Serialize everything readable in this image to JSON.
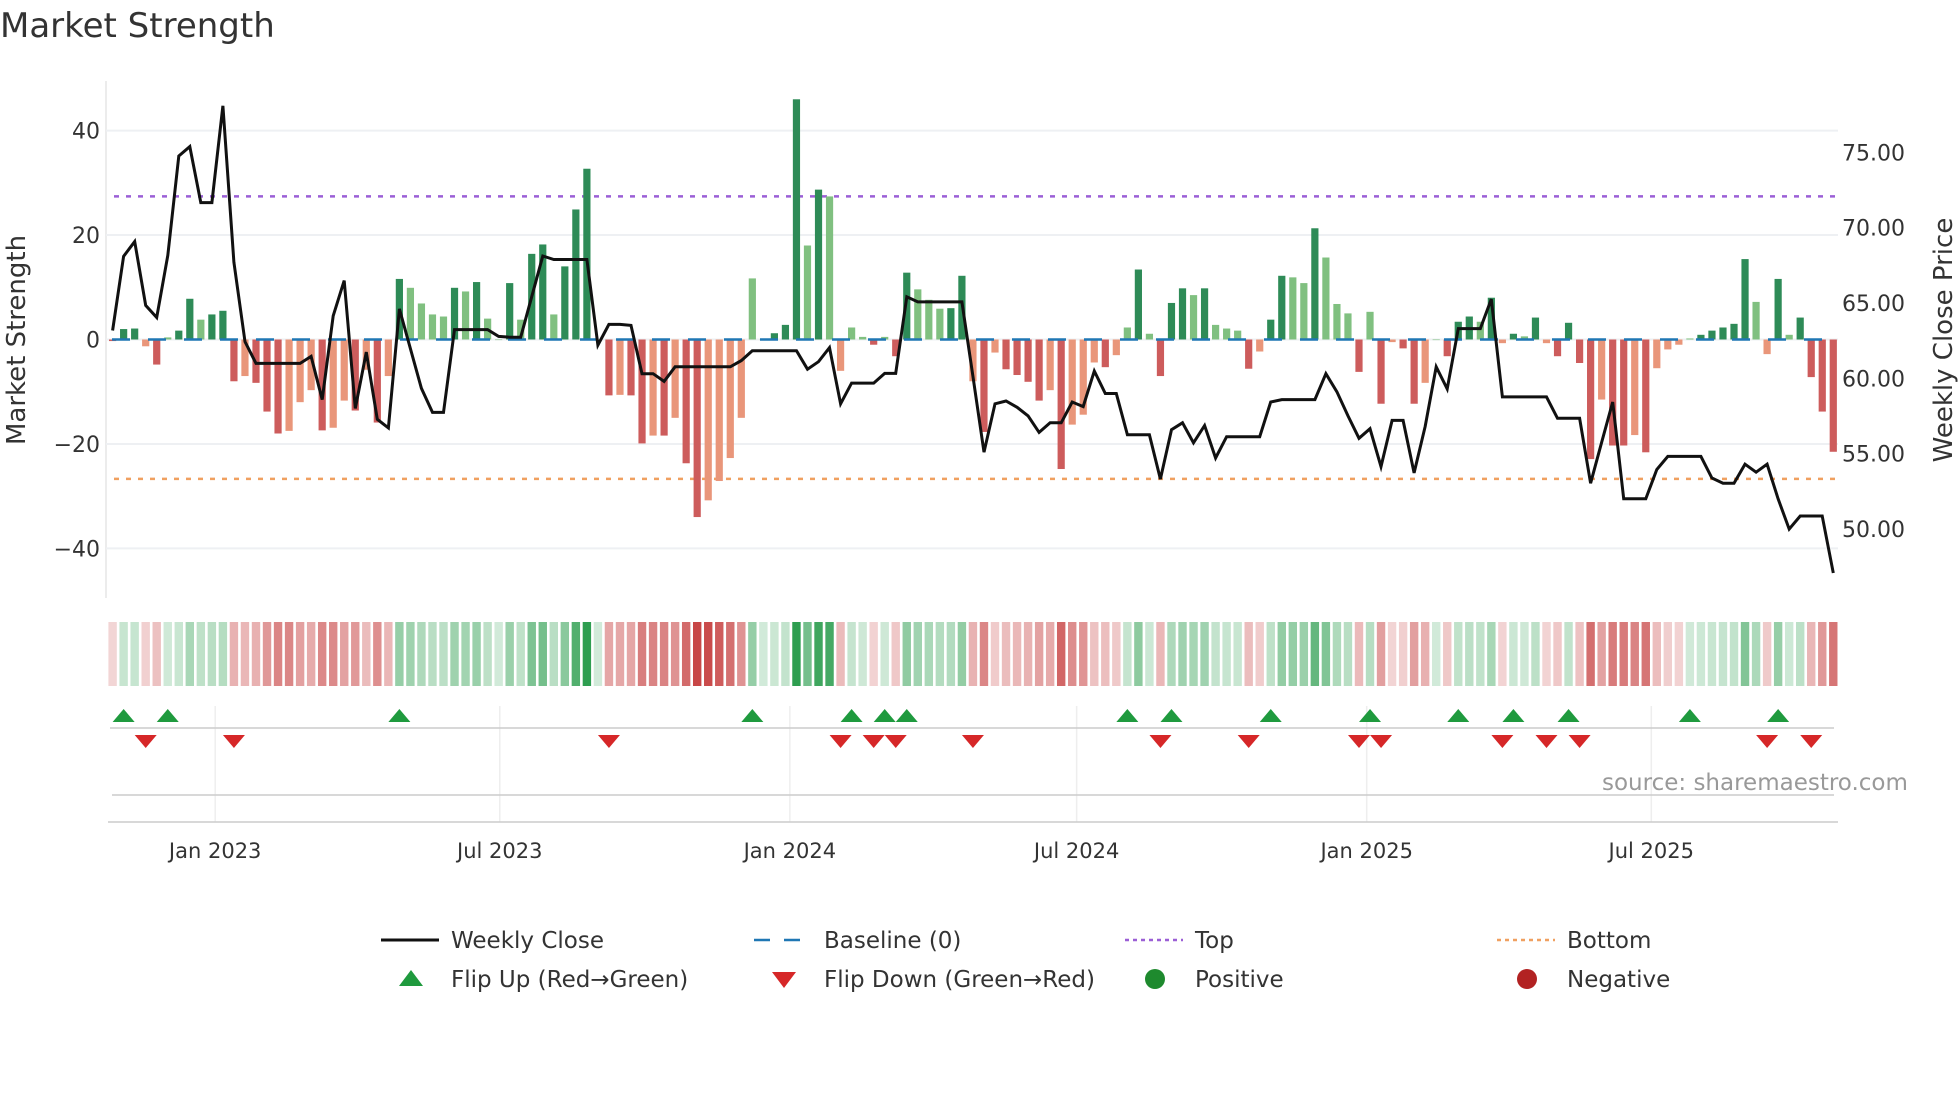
{
  "title": "Market Strength",
  "source": "source: sharemaestro.com",
  "colors": {
    "strong_green": "#2e8b57",
    "light_green": "#80c080",
    "strong_red": "#cd5c5c",
    "light_red": "#e9967a",
    "baseline": "#1f77b4",
    "top": "#9b5fd6",
    "bottom": "#f0a060",
    "flip_up": "#1f9a3e",
    "flip_down": "#d62728",
    "positive": "#1e8a2e",
    "negative": "#b22222"
  },
  "chart_data": {
    "type": "bar",
    "title": "Market Strength",
    "ylabel": "Market Strength",
    "y2label": "Weekly Close Price",
    "ylim": [
      -49.5,
      49.5
    ],
    "y2lim": [
      45.4,
      79.75
    ],
    "yticks": [
      40,
      20,
      0,
      -20,
      -40
    ],
    "yticklabels": [
      "40",
      "20",
      "0",
      "−20",
      "−40"
    ],
    "y2ticks": [
      75,
      70,
      65,
      60,
      55,
      50
    ],
    "y2ticklabels": [
      "75.00",
      "70.00",
      "65.00",
      "60.00",
      "55.00",
      "50.00"
    ],
    "xticks": [
      {
        "index": 9.3,
        "label": "Jan 2023"
      },
      {
        "index": 35.1,
        "label": "Jul 2023"
      },
      {
        "index": 61.4,
        "label": "Jan 2024"
      },
      {
        "index": 87.4,
        "label": "Jul 2024"
      },
      {
        "index": 113.7,
        "label": "Jan 2025"
      },
      {
        "index": 139.5,
        "label": "Jul 2025"
      }
    ],
    "top_level": 27.4,
    "bottom_level": -26.7,
    "baseline": 0,
    "grid": true,
    "legend_position": "bottom",
    "strength": [
      -0.3,
      2,
      2.1,
      -1.3,
      -4.8,
      0.4,
      1.7,
      7.8,
      3.8,
      4.8,
      5.5,
      -8,
      -7,
      -8.3,
      -13.8,
      -18,
      -17.5,
      -12,
      -9.7,
      -17.4,
      -16.9,
      -11.7,
      -13.6,
      -5.8,
      -15.9,
      -7,
      11.6,
      9.9,
      6.9,
      4.8,
      4.4,
      9.9,
      9.2,
      11,
      4,
      0,
      10.8,
      3.8,
      16.4,
      18.2,
      4.8,
      14,
      24.9,
      32.7,
      0,
      -10.7,
      -10.6,
      -10.7,
      -19.9,
      -18.4,
      -18.4,
      -15,
      -23.7,
      -34,
      -30.8,
      -27.1,
      -22.7,
      -15,
      11.7,
      0,
      1.2,
      2.8,
      46,
      18,
      28.7,
      27.4,
      -6,
      2.3,
      0.5,
      -1,
      0.5,
      -3.2,
      12.8,
      9.6,
      7.6,
      5.9,
      6,
      12.2,
      -8,
      -17.7,
      -2.5,
      -5.7,
      -6.8,
      -8.1,
      -11.7,
      -9.7,
      -24.8,
      -16.3,
      -14.4,
      -4.4,
      -5.3,
      -3,
      2.3,
      13.4,
      1.1,
      -7,
      7,
      9.8,
      8.5,
      9.8,
      2.8,
      2.1,
      1.7,
      -5.6,
      -2.3,
      3.8,
      12.2,
      11.9,
      10.8,
      21.3,
      15.7,
      6.8,
      5,
      -6.2,
      5.3,
      -12.3,
      -0.5,
      -1.7,
      -12.3,
      -8.3,
      0,
      -3.2,
      3.4,
      4.4,
      3.4,
      8,
      -0.7,
      1.1,
      0.6,
      4.2,
      -0.7,
      -3.2,
      3.2,
      -4.5,
      -22.9,
      -11.5,
      -20.3,
      -20.3,
      -18.3,
      -21.6,
      -5.5,
      -1.9,
      -1,
      0.2,
      0.9,
      1.7,
      2.3,
      3,
      15.4,
      7.2,
      -2.8,
      11.6,
      0.9,
      4.2,
      -7.2,
      -13.8,
      -21.5
    ],
    "weekly_close": [
      63.17,
      68.1,
      69.08,
      64.84,
      64.04,
      68.16,
      74.77,
      75.39,
      71.67,
      71.67,
      78.1,
      67.71,
      62.43,
      60.99,
      60.99,
      60.99,
      60.99,
      60.99,
      61.45,
      58.58,
      64.15,
      66.49,
      58.0,
      61.74,
      57.27,
      56.7,
      64.61,
      61.97,
      59.33,
      57.73,
      57.73,
      63.23,
      63.23,
      63.23,
      63.23,
      62.78,
      62.73,
      62.73,
      65.41,
      68.12,
      67.89,
      67.89,
      67.89,
      67.89,
      62.2,
      63.58,
      63.58,
      63.51,
      60.3,
      60.3,
      59.79,
      60.76,
      60.76,
      60.76,
      60.76,
      60.76,
      60.76,
      61.17,
      61.83,
      61.83,
      61.83,
      61.83,
      61.83,
      60.6,
      61.1,
      62.04,
      58.3,
      59.68,
      59.68,
      59.68,
      60.32,
      60.32,
      65.41,
      65.07,
      65.07,
      65.07,
      65.07,
      65.07,
      60.14,
      55.09,
      58.3,
      58.49,
      58.07,
      57.5,
      56.4,
      57.04,
      57.04,
      58.42,
      58.12,
      60.48,
      58.99,
      58.99,
      56.24,
      56.24,
      56.24,
      53.3,
      56.58,
      57.04,
      55.71,
      56.86,
      54.7,
      56.12,
      56.12,
      56.12,
      56.12,
      58.42,
      58.58,
      58.58,
      58.58,
      58.58,
      60.3,
      59.1,
      57.5,
      56.01,
      56.65,
      54.13,
      57.2,
      57.2,
      53.71,
      56.81,
      60.76,
      59.29,
      63.3,
      63.3,
      63.3,
      65.25,
      58.76,
      58.76,
      58.76,
      58.76,
      58.76,
      57.34,
      57.34,
      57.34,
      53.03,
      55.73,
      58.42,
      51.99,
      51.99,
      51.99,
      53.94,
      54.81,
      54.81,
      54.81,
      54.81,
      53.37,
      53.03,
      53.03,
      54.29,
      53.76,
      54.29,
      51.99,
      49.98,
      50.85,
      50.85,
      50.85,
      47.06
    ]
  },
  "legend": [
    {
      "label": "Weekly Close",
      "symbol": "line"
    },
    {
      "label": "Baseline (0)",
      "symbol": "dash"
    },
    {
      "label": "Top",
      "symbol": "dot-purple"
    },
    {
      "label": "Bottom",
      "symbol": "dot-orange"
    },
    {
      "label": "Flip Up (Red→Green)",
      "symbol": "triangle-up"
    },
    {
      "label": "Flip Down (Green→Red)",
      "symbol": "triangle-down"
    },
    {
      "label": "Positive",
      "symbol": "circle-green"
    },
    {
      "label": "Negative",
      "symbol": "circle-red"
    }
  ]
}
